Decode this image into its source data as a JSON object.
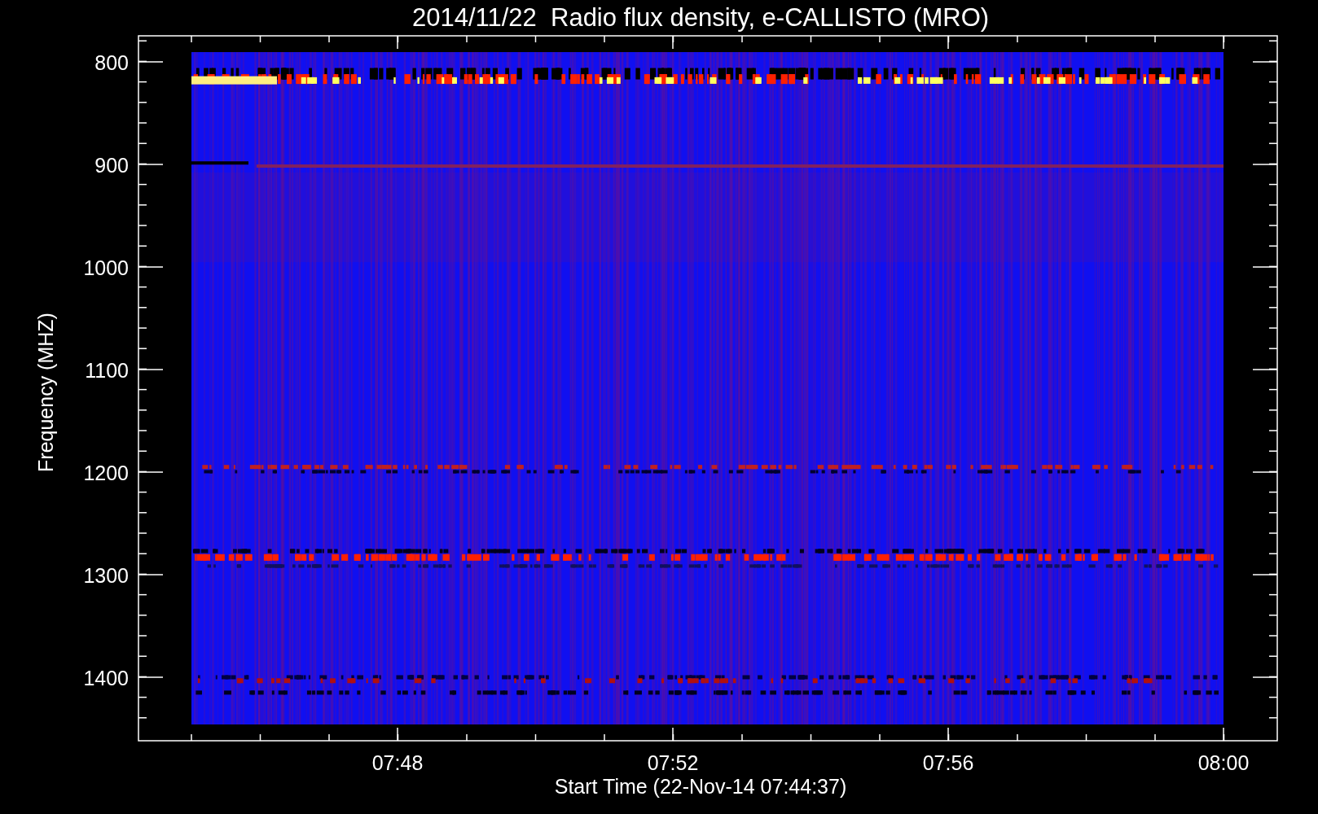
{
  "title": "2014/11/22  Radio flux density, e-CALLISTO (MRO)",
  "y_axis": {
    "label": "Frequency (MHZ)",
    "ticks": [
      "800",
      "900",
      "1000",
      "1100",
      "1200",
      "1300",
      "1400"
    ]
  },
  "x_axis": {
    "label": "Start Time (22-Nov-14 07:44:37)",
    "ticks": [
      "07:48",
      "07:52",
      "07:56",
      "08:00"
    ]
  }
}
